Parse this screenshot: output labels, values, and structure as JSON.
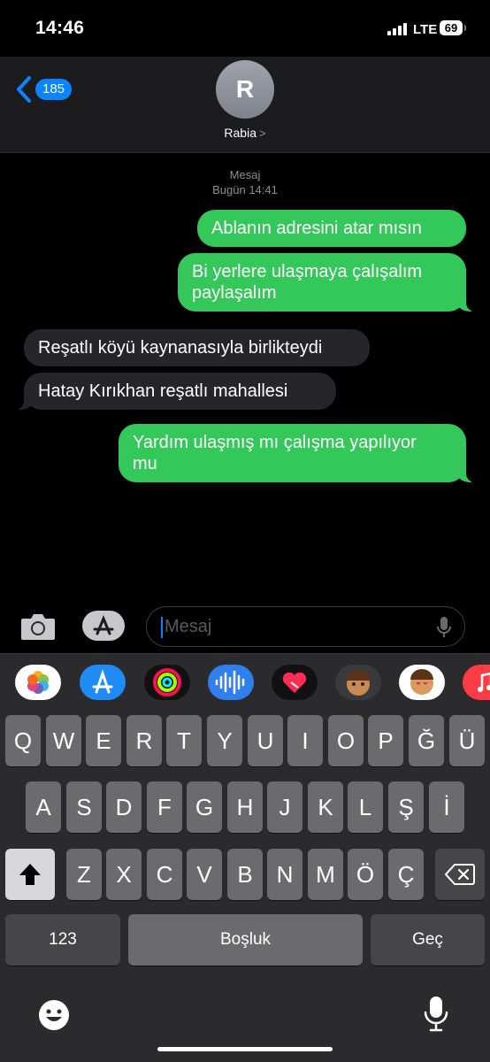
{
  "status_bar": {
    "time": "14:46",
    "network": "LTE",
    "battery": "69"
  },
  "header": {
    "back_count": "185",
    "avatar_initial": "R",
    "contact_name": "Rabia"
  },
  "conversation": {
    "service": "Mesaj",
    "timestamp": "Bugün 14:41",
    "messages": [
      {
        "from": "me",
        "lines": [
          "Ablanın adresini atar mısın"
        ]
      },
      {
        "from": "me",
        "lines": [
          "Bi yerlere ulaşmaya çalışalım",
          "paylaşalım"
        ]
      },
      {
        "from": "them",
        "lines": [
          "Reşatlı köyü kaynanasıyla birlikteydi"
        ]
      },
      {
        "from": "them",
        "lines": [
          "Hatay Kırıkhan reşatlı mahallesi"
        ]
      },
      {
        "from": "me",
        "lines": [
          "Yardım ulaşmış mı çalışma yapılıyor",
          "mu"
        ]
      }
    ]
  },
  "input": {
    "placeholder": "Mesaj"
  },
  "app_drawer": [
    "photos-icon",
    "app-store-icon",
    "activity-icon",
    "audio-message-icon",
    "digital-touch-icon",
    "memoji-icon",
    "memoji-stickers-icon",
    "music-icon"
  ],
  "keyboard": {
    "row1": [
      "Q",
      "W",
      "E",
      "R",
      "T",
      "Y",
      "U",
      "I",
      "O",
      "P",
      "Ğ",
      "Ü"
    ],
    "row2": [
      "A",
      "S",
      "D",
      "F",
      "G",
      "H",
      "J",
      "K",
      "L",
      "Ş",
      "İ"
    ],
    "row3": [
      "Z",
      "X",
      "C",
      "V",
      "B",
      "N",
      "M",
      "Ö",
      "Ç"
    ],
    "numbers_key": "123",
    "space_key": "Boşluk",
    "return_key": "Geç"
  },
  "colors": {
    "sent_bubble": "#34c759",
    "received_bubble": "#26252a",
    "accent": "#0a84ff"
  }
}
